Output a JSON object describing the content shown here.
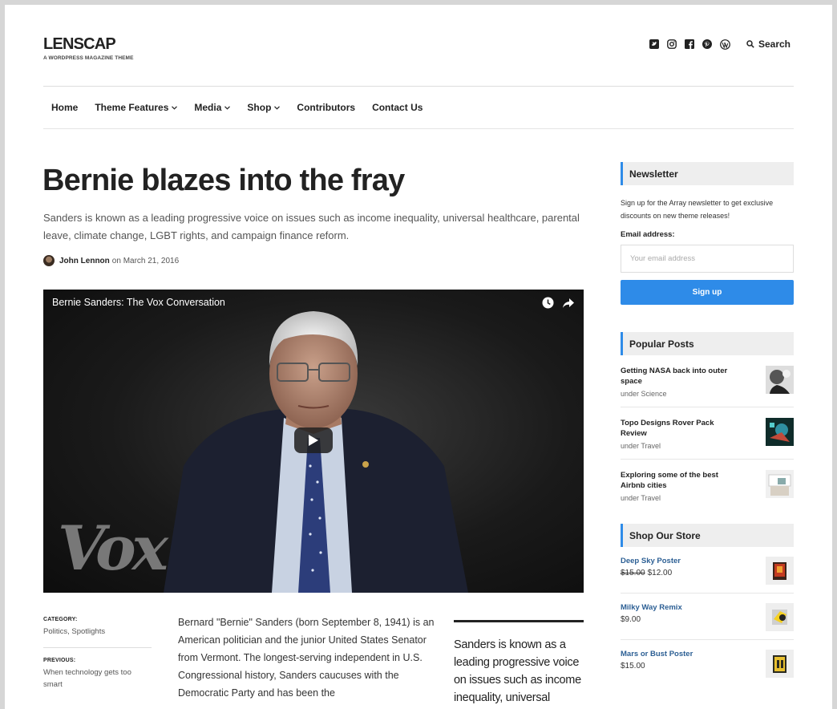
{
  "site": {
    "logo": "LENSCAP",
    "tagline": "A WORDPRESS MAGAZINE THEME"
  },
  "header": {
    "social_icons": [
      "twitter-icon",
      "instagram-icon",
      "facebook-icon",
      "pinterest-icon",
      "wordpress-icon"
    ],
    "search_label": "Search"
  },
  "nav": {
    "items": [
      {
        "label": "Home",
        "dropdown": false
      },
      {
        "label": "Theme Features",
        "dropdown": true
      },
      {
        "label": "Media",
        "dropdown": true
      },
      {
        "label": "Shop",
        "dropdown": true
      },
      {
        "label": "Contributors",
        "dropdown": false
      },
      {
        "label": "Contact Us",
        "dropdown": false
      }
    ]
  },
  "article": {
    "title": "Bernie blazes into the fray",
    "dek": "Sanders is known as a leading progressive voice on issues such as income inequality, universal healthcare, parental leave, climate change, LGBT rights, and campaign finance reform.",
    "author": "John Lennon",
    "date_prefix": "on",
    "date": "March 21, 2016",
    "video": {
      "title": "Bernie Sanders: The Vox Conversation",
      "watermark": "Vox"
    },
    "meta": {
      "category_label": "CATEGORY:",
      "category_value": "Politics, Spotlights",
      "previous_label": "PREVIOUS:",
      "previous_value": "When technology gets too smart"
    },
    "body": "Bernard \"Bernie\" Sanders (born September 8, 1941) is an American politician and the junior United States Senator from Vermont. The longest-serving independent in U.S. Congressional history, Sanders caucuses with the Democratic Party and has been the",
    "pullquote": "Sanders is known as a leading progressive voice on issues such as income inequality, universal"
  },
  "sidebar": {
    "newsletter": {
      "title": "Newsletter",
      "description": "Sign up for the Array newsletter to get exclusive discounts on new theme releases!",
      "email_label": "Email address:",
      "email_placeholder": "Your email address",
      "button": "Sign up"
    },
    "popular": {
      "title": "Popular Posts",
      "items": [
        {
          "title": "Getting NASA back into outer space",
          "category": "under Science"
        },
        {
          "title": "Topo Designs Rover Pack Review",
          "category": "under Travel"
        },
        {
          "title": "Exploring some of the best Airbnb cities",
          "category": "under Travel"
        }
      ]
    },
    "store": {
      "title": "Shop Our Store",
      "items": [
        {
          "name": "Deep Sky Poster",
          "old_price": "$15.00",
          "price": "$12.00"
        },
        {
          "name": "Milky Way Remix",
          "old_price": "",
          "price": "$9.00"
        },
        {
          "name": "Mars or Bust Poster",
          "old_price": "",
          "price": "$15.00"
        }
      ]
    }
  },
  "colors": {
    "accent": "#2e8be8",
    "text": "#222222",
    "muted": "#555555"
  }
}
